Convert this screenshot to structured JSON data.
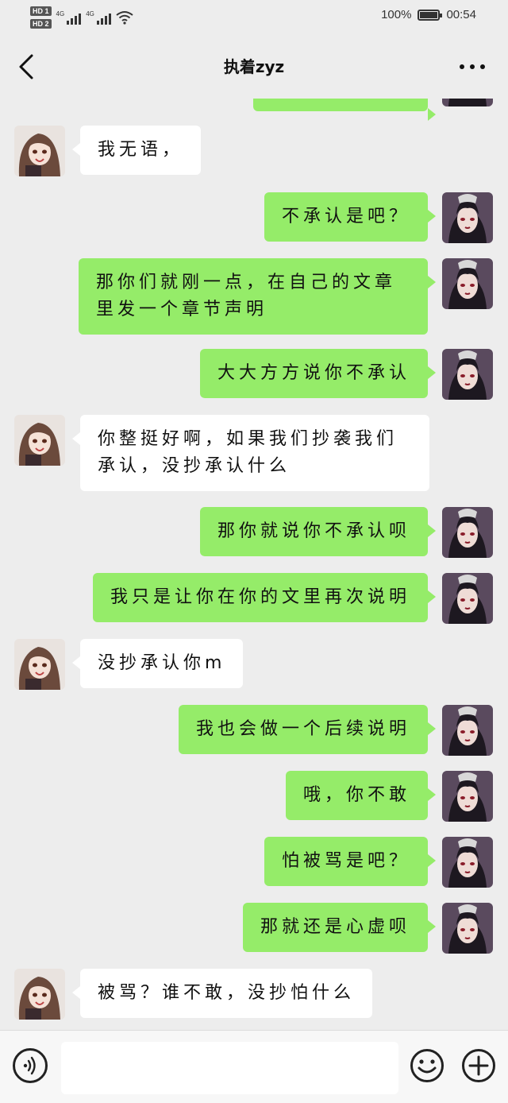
{
  "status_bar": {
    "hd1": "HD 1",
    "hd2": "HD 2",
    "network1": "4G",
    "network2": "4G",
    "battery": "100%",
    "time": "00:54"
  },
  "header": {
    "title": "执着zyz"
  },
  "colors": {
    "my_bubble": "#95ec69",
    "other_bubble": "#ffffff",
    "background": "#ededed"
  },
  "messages": [
    {
      "sender": "me",
      "text": ""
    },
    {
      "sender": "other",
      "text": "我无语，"
    },
    {
      "sender": "me",
      "text": "不承认是吧？"
    },
    {
      "sender": "me",
      "text": "那你们就刚一点，在自己的文章里发一个章节声明"
    },
    {
      "sender": "me",
      "text": "大大方方说你不承认"
    },
    {
      "sender": "other",
      "text": "你整挺好啊，如果我们抄袭我们承认，没抄承认什么"
    },
    {
      "sender": "me",
      "text": "那你就说你不承认呗"
    },
    {
      "sender": "me",
      "text": "我只是让你在你的文里再次说明"
    },
    {
      "sender": "other",
      "text": "没抄承认你m"
    },
    {
      "sender": "me",
      "text": "我也会做一个后续说明"
    },
    {
      "sender": "me",
      "text": "哦，你不敢"
    },
    {
      "sender": "me",
      "text": "怕被骂是吧？"
    },
    {
      "sender": "me",
      "text": "那就还是心虚呗"
    },
    {
      "sender": "other",
      "text": "被骂？谁不敢，没抄怕什么"
    }
  ],
  "input_bar": {
    "voice_icon": "voice-icon",
    "emoji_icon": "emoji-icon",
    "plus_icon": "plus-icon",
    "input_value": ""
  }
}
